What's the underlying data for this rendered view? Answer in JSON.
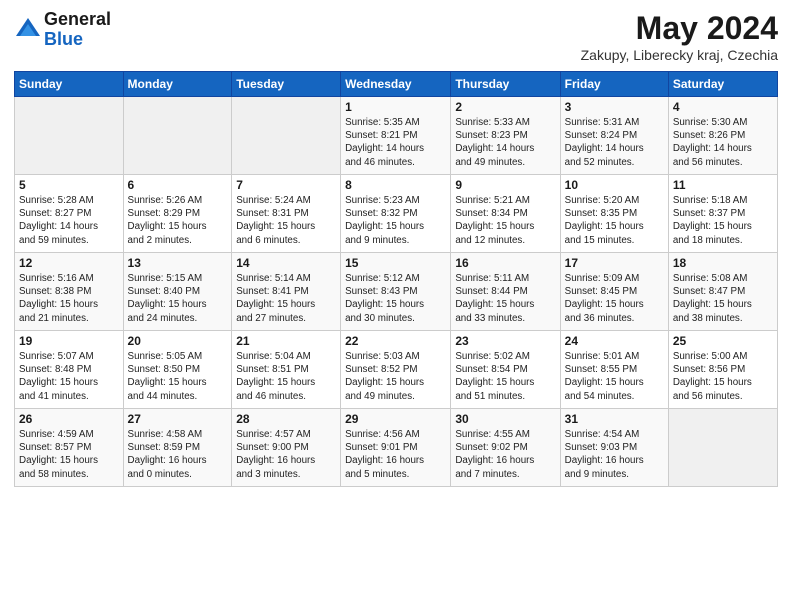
{
  "header": {
    "logo_general": "General",
    "logo_blue": "Blue",
    "month_year": "May 2024",
    "location": "Zakupy, Liberecky kraj, Czechia"
  },
  "weekdays": [
    "Sunday",
    "Monday",
    "Tuesday",
    "Wednesday",
    "Thursday",
    "Friday",
    "Saturday"
  ],
  "weeks": [
    [
      {
        "day": "",
        "info": ""
      },
      {
        "day": "",
        "info": ""
      },
      {
        "day": "",
        "info": ""
      },
      {
        "day": "1",
        "info": "Sunrise: 5:35 AM\nSunset: 8:21 PM\nDaylight: 14 hours\nand 46 minutes."
      },
      {
        "day": "2",
        "info": "Sunrise: 5:33 AM\nSunset: 8:23 PM\nDaylight: 14 hours\nand 49 minutes."
      },
      {
        "day": "3",
        "info": "Sunrise: 5:31 AM\nSunset: 8:24 PM\nDaylight: 14 hours\nand 52 minutes."
      },
      {
        "day": "4",
        "info": "Sunrise: 5:30 AM\nSunset: 8:26 PM\nDaylight: 14 hours\nand 56 minutes."
      }
    ],
    [
      {
        "day": "5",
        "info": "Sunrise: 5:28 AM\nSunset: 8:27 PM\nDaylight: 14 hours\nand 59 minutes."
      },
      {
        "day": "6",
        "info": "Sunrise: 5:26 AM\nSunset: 8:29 PM\nDaylight: 15 hours\nand 2 minutes."
      },
      {
        "day": "7",
        "info": "Sunrise: 5:24 AM\nSunset: 8:31 PM\nDaylight: 15 hours\nand 6 minutes."
      },
      {
        "day": "8",
        "info": "Sunrise: 5:23 AM\nSunset: 8:32 PM\nDaylight: 15 hours\nand 9 minutes."
      },
      {
        "day": "9",
        "info": "Sunrise: 5:21 AM\nSunset: 8:34 PM\nDaylight: 15 hours\nand 12 minutes."
      },
      {
        "day": "10",
        "info": "Sunrise: 5:20 AM\nSunset: 8:35 PM\nDaylight: 15 hours\nand 15 minutes."
      },
      {
        "day": "11",
        "info": "Sunrise: 5:18 AM\nSunset: 8:37 PM\nDaylight: 15 hours\nand 18 minutes."
      }
    ],
    [
      {
        "day": "12",
        "info": "Sunrise: 5:16 AM\nSunset: 8:38 PM\nDaylight: 15 hours\nand 21 minutes."
      },
      {
        "day": "13",
        "info": "Sunrise: 5:15 AM\nSunset: 8:40 PM\nDaylight: 15 hours\nand 24 minutes."
      },
      {
        "day": "14",
        "info": "Sunrise: 5:14 AM\nSunset: 8:41 PM\nDaylight: 15 hours\nand 27 minutes."
      },
      {
        "day": "15",
        "info": "Sunrise: 5:12 AM\nSunset: 8:43 PM\nDaylight: 15 hours\nand 30 minutes."
      },
      {
        "day": "16",
        "info": "Sunrise: 5:11 AM\nSunset: 8:44 PM\nDaylight: 15 hours\nand 33 minutes."
      },
      {
        "day": "17",
        "info": "Sunrise: 5:09 AM\nSunset: 8:45 PM\nDaylight: 15 hours\nand 36 minutes."
      },
      {
        "day": "18",
        "info": "Sunrise: 5:08 AM\nSunset: 8:47 PM\nDaylight: 15 hours\nand 38 minutes."
      }
    ],
    [
      {
        "day": "19",
        "info": "Sunrise: 5:07 AM\nSunset: 8:48 PM\nDaylight: 15 hours\nand 41 minutes."
      },
      {
        "day": "20",
        "info": "Sunrise: 5:05 AM\nSunset: 8:50 PM\nDaylight: 15 hours\nand 44 minutes."
      },
      {
        "day": "21",
        "info": "Sunrise: 5:04 AM\nSunset: 8:51 PM\nDaylight: 15 hours\nand 46 minutes."
      },
      {
        "day": "22",
        "info": "Sunrise: 5:03 AM\nSunset: 8:52 PM\nDaylight: 15 hours\nand 49 minutes."
      },
      {
        "day": "23",
        "info": "Sunrise: 5:02 AM\nSunset: 8:54 PM\nDaylight: 15 hours\nand 51 minutes."
      },
      {
        "day": "24",
        "info": "Sunrise: 5:01 AM\nSunset: 8:55 PM\nDaylight: 15 hours\nand 54 minutes."
      },
      {
        "day": "25",
        "info": "Sunrise: 5:00 AM\nSunset: 8:56 PM\nDaylight: 15 hours\nand 56 minutes."
      }
    ],
    [
      {
        "day": "26",
        "info": "Sunrise: 4:59 AM\nSunset: 8:57 PM\nDaylight: 15 hours\nand 58 minutes."
      },
      {
        "day": "27",
        "info": "Sunrise: 4:58 AM\nSunset: 8:59 PM\nDaylight: 16 hours\nand 0 minutes."
      },
      {
        "day": "28",
        "info": "Sunrise: 4:57 AM\nSunset: 9:00 PM\nDaylight: 16 hours\nand 3 minutes."
      },
      {
        "day": "29",
        "info": "Sunrise: 4:56 AM\nSunset: 9:01 PM\nDaylight: 16 hours\nand 5 minutes."
      },
      {
        "day": "30",
        "info": "Sunrise: 4:55 AM\nSunset: 9:02 PM\nDaylight: 16 hours\nand 7 minutes."
      },
      {
        "day": "31",
        "info": "Sunrise: 4:54 AM\nSunset: 9:03 PM\nDaylight: 16 hours\nand 9 minutes."
      },
      {
        "day": "",
        "info": ""
      }
    ]
  ]
}
